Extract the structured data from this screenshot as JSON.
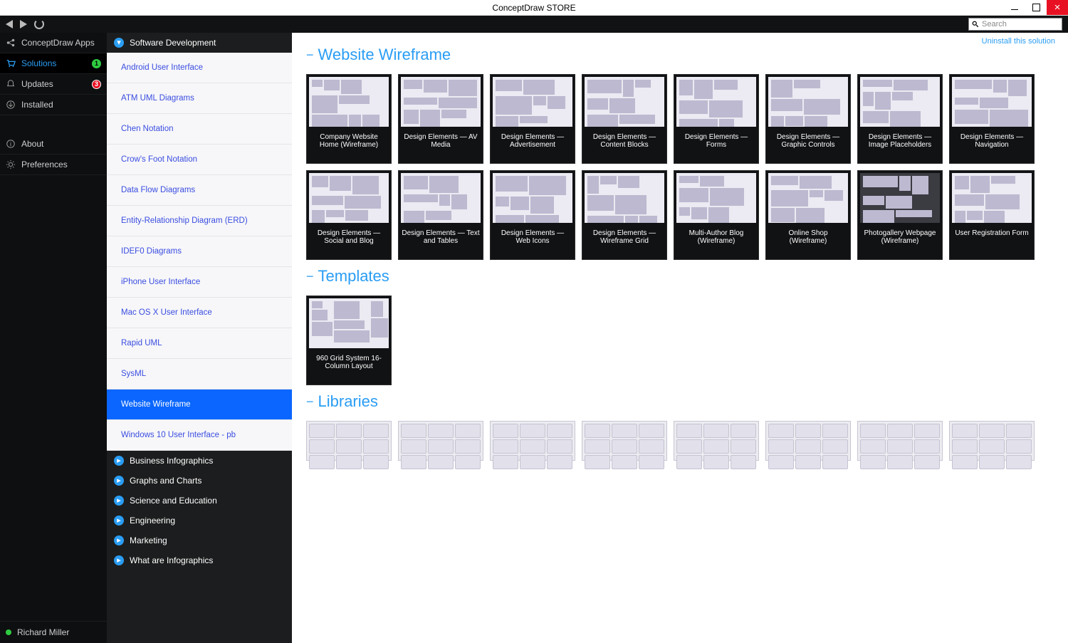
{
  "window": {
    "title": "ConceptDraw STORE"
  },
  "toolbar": {
    "search_placeholder": "Search"
  },
  "uninstall_link": "Uninstall this solution",
  "sidebar1": {
    "items": [
      {
        "id": "apps",
        "label": "ConceptDraw Apps",
        "icon": "share"
      },
      {
        "id": "solutions",
        "label": "Solutions",
        "icon": "cart",
        "selected": true,
        "badge": "1",
        "badge_kind": "green"
      },
      {
        "id": "updates",
        "label": "Updates",
        "icon": "bell",
        "badge": "3",
        "badge_kind": "red"
      },
      {
        "id": "installed",
        "label": "Installed",
        "icon": "download"
      }
    ],
    "items2": [
      {
        "id": "about",
        "label": "About",
        "icon": "info"
      },
      {
        "id": "prefs",
        "label": "Preferences",
        "icon": "gear"
      }
    ],
    "user": "Richard Miller"
  },
  "sidebar2": {
    "top_cat": "Software Development",
    "subs": [
      "Android User Interface",
      "ATM UML Diagrams",
      "Chen Notation",
      "Crow's Foot Notation",
      "Data Flow Diagrams",
      "Entity-Relationship Diagram (ERD)",
      "IDEF0 Diagrams",
      "iPhone User Interface",
      "Mac OS X User Interface",
      "Rapid UML",
      "SysML",
      "Website Wireframe",
      "Windows 10 User Interface - pb"
    ],
    "selected_sub": "Website Wireframe",
    "bottom_cats": [
      "Business Infographics",
      "Graphs and Charts",
      "Science and Education",
      "Engineering",
      "Marketing",
      "What are Infographics"
    ]
  },
  "content": {
    "sections": [
      {
        "title": "Website Wireframe",
        "items": [
          "Company Website Home (Wireframe)",
          "Design Elements — AV Media",
          "Design Elements — Advertisement",
          "Design Elements — Content Blocks",
          "Design Elements — Forms",
          "Design Elements — Graphic Controls",
          "Design Elements — Image Placeholders",
          "Design Elements — Navigation",
          "Design Elements — Social and Blog",
          "Design Elements — Text and Tables",
          "Design Elements — Web Icons",
          "Design Elements — Wireframe Grid",
          "Multi-Author Blog (Wireframe)",
          "Online Shop (Wireframe)",
          "Photogallery Webpage (Wireframe)",
          "User Registration Form"
        ]
      },
      {
        "title": "Templates",
        "items": [
          "960 Grid System 16-Column Layout"
        ]
      },
      {
        "title": "Libraries",
        "items": [
          "",
          "",
          "",
          "",
          "",
          "",
          "",
          ""
        ]
      }
    ]
  }
}
